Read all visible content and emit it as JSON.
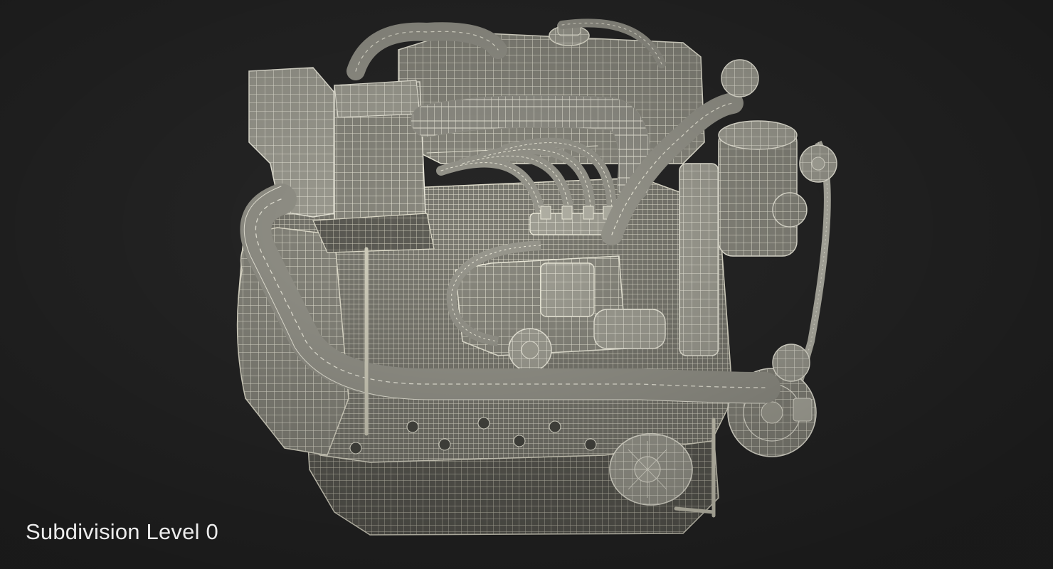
{
  "viewport": {
    "caption": "Subdivision Level 0",
    "background_color": "#272727",
    "mesh_fill_color": "#8f8e84",
    "wire_color": "#f1efdf"
  },
  "model": {
    "subject": "engine-wireframe-render"
  }
}
